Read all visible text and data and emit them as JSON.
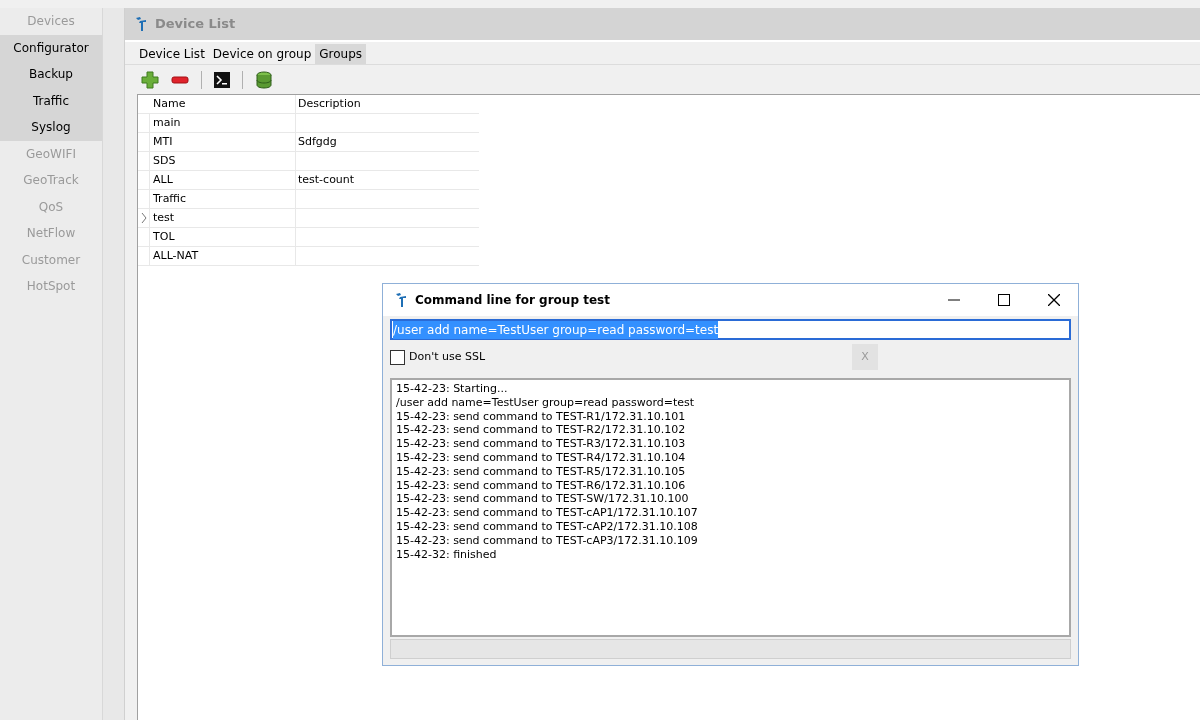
{
  "sidebar": {
    "items": [
      {
        "label": "Devices",
        "enabled": false
      },
      {
        "label": "Configurator",
        "enabled": true
      },
      {
        "label": "Backup",
        "enabled": true
      },
      {
        "label": "Traffic",
        "enabled": true
      },
      {
        "label": "Syslog",
        "enabled": true
      },
      {
        "label": "GeoWIFI",
        "enabled": false
      },
      {
        "label": "GeoTrack",
        "enabled": false
      },
      {
        "label": "QoS",
        "enabled": false
      },
      {
        "label": "NetFlow",
        "enabled": false
      },
      {
        "label": "Customer",
        "enabled": false
      },
      {
        "label": "HotSpot",
        "enabled": false
      }
    ]
  },
  "panel": {
    "title": "Device List"
  },
  "tabs": [
    {
      "label": "Device List",
      "selected": false
    },
    {
      "label": "Device on group",
      "selected": false
    },
    {
      "label": "Groups",
      "selected": true
    }
  ],
  "toolbar": [
    {
      "kind": "add"
    },
    {
      "kind": "remove"
    },
    {
      "kind": "separator"
    },
    {
      "kind": "terminal"
    },
    {
      "kind": "separator"
    },
    {
      "kind": "database"
    }
  ],
  "table": {
    "columns": [
      "Name",
      "Description"
    ],
    "rows": [
      {
        "name": "main",
        "description": "",
        "selected": false
      },
      {
        "name": "MTI",
        "description": "Sdfgdg",
        "selected": false
      },
      {
        "name": "SDS",
        "description": "",
        "selected": false
      },
      {
        "name": "ALL",
        "description": "test-count",
        "selected": false
      },
      {
        "name": "Traffic",
        "description": "",
        "selected": false
      },
      {
        "name": "test",
        "description": "",
        "selected": true
      },
      {
        "name": "TOL",
        "description": "",
        "selected": false
      },
      {
        "name": "ALL-NAT",
        "description": "",
        "selected": false
      }
    ]
  },
  "dialog": {
    "title": "Command line for group test",
    "command": {
      "value": "/user add name=TestUser group=read password=test",
      "text_selected": true
    },
    "ssl_checkbox": {
      "label": "Don't use SSL",
      "checked": false
    },
    "clear_button": "X",
    "log": [
      "15-42-23: Starting...",
      "/user add name=TestUser group=read password=test",
      "15-42-23: send command to TEST-R1/172.31.10.101",
      "15-42-23: send command to TEST-R2/172.31.10.102",
      "15-42-23: send command to TEST-R3/172.31.10.103",
      "15-42-23: send command to TEST-R4/172.31.10.104",
      "15-42-23: send command to TEST-R5/172.31.10.105",
      "15-42-23: send command to TEST-R6/172.31.10.106",
      "15-42-23: send command to TEST-SW/172.31.10.100",
      "15-42-23: send command to TEST-cAP1/172.31.10.107",
      "15-42-23: send command to TEST-cAP2/172.31.10.108",
      "15-42-23: send command to TEST-cAP3/172.31.10.109",
      "15-42-32: finished"
    ]
  }
}
